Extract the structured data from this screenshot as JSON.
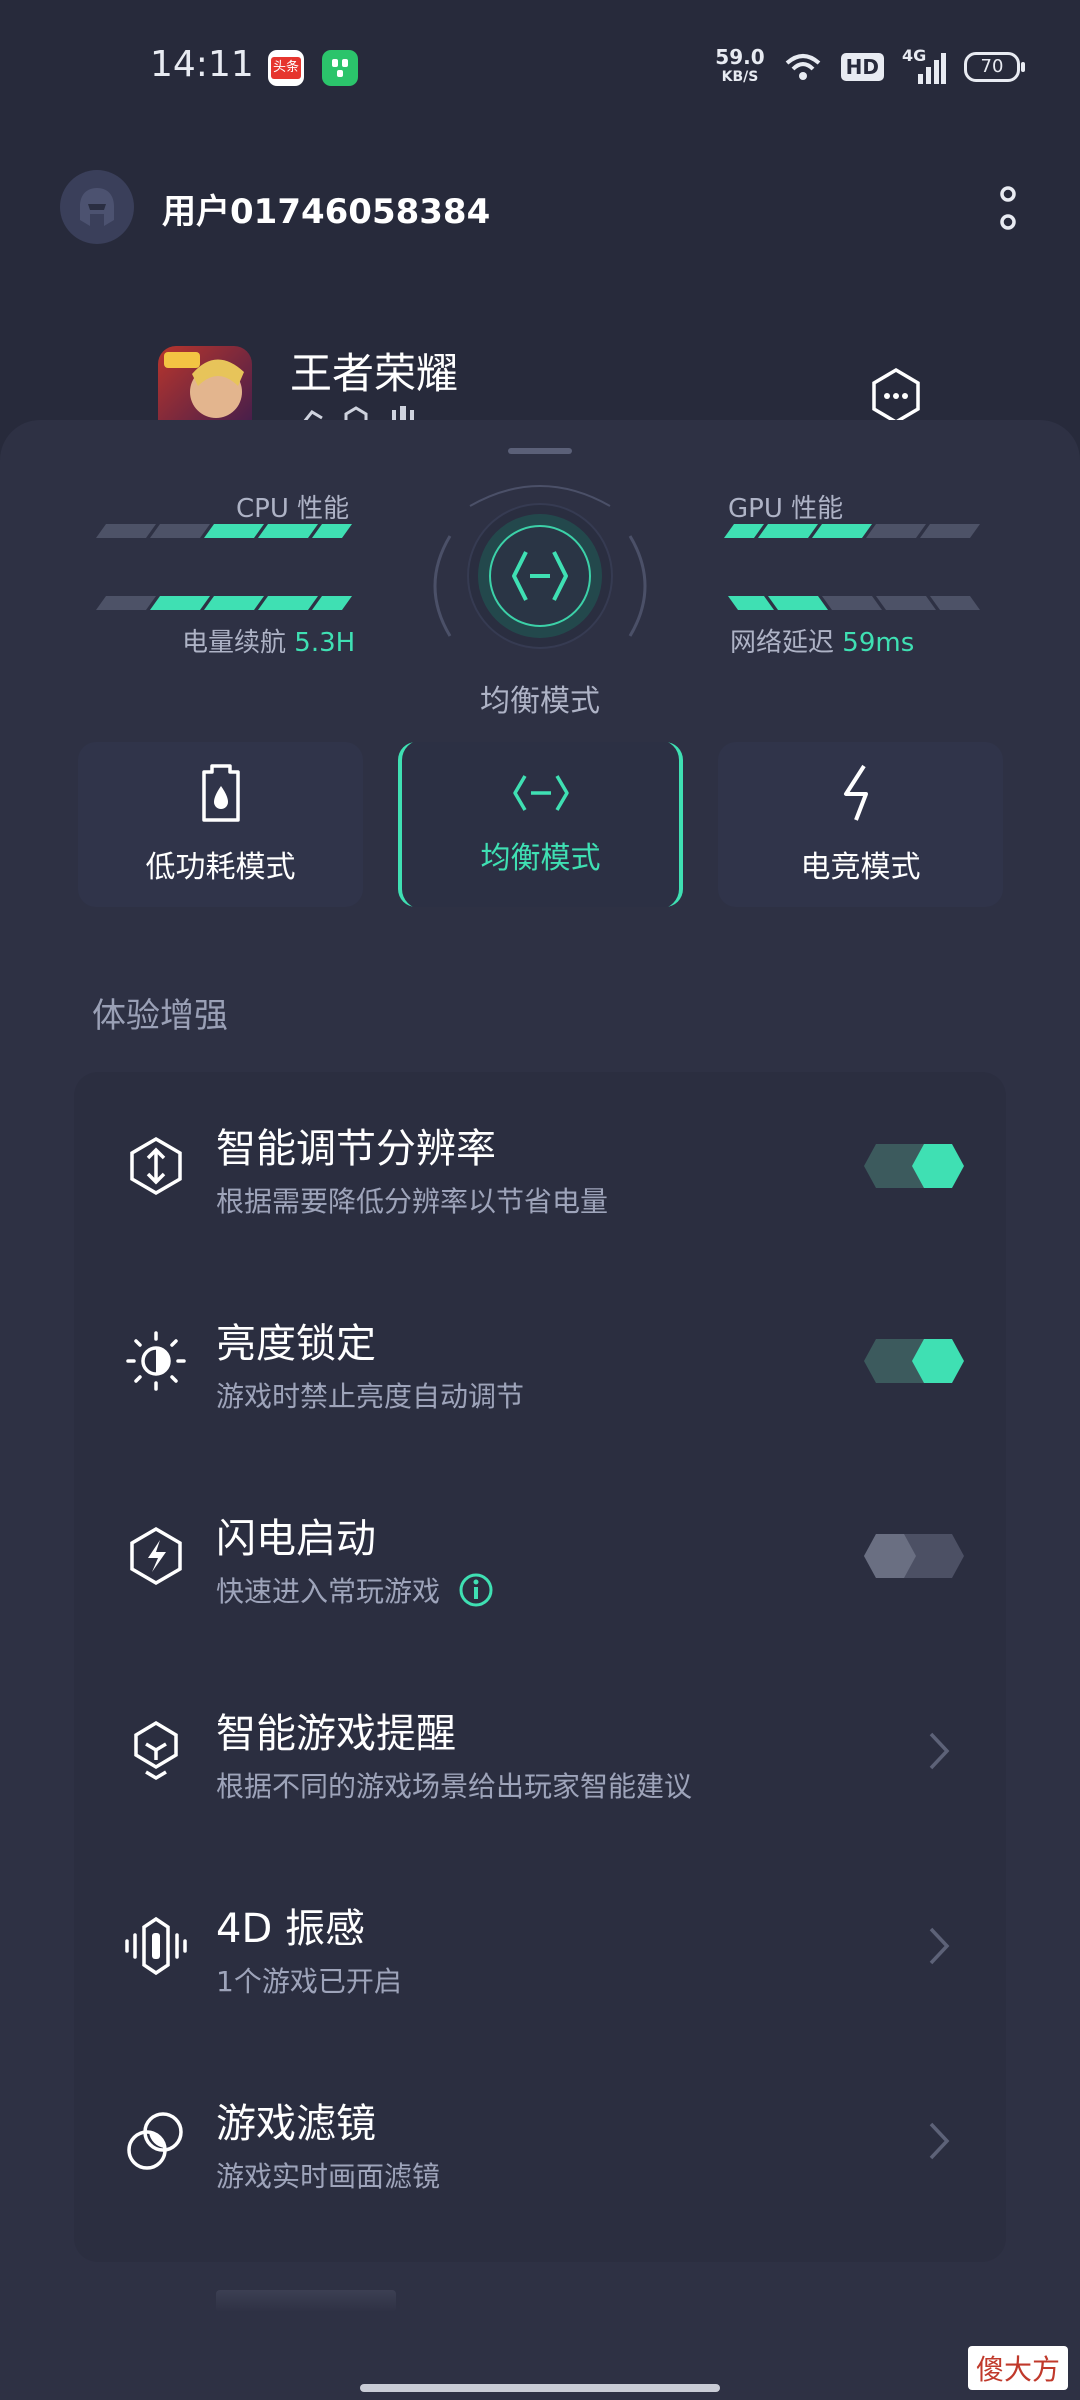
{
  "status_bar": {
    "time": "14:11",
    "speed_value": "59.0",
    "speed_unit": "KB/S",
    "hd": "HD",
    "network": "4G",
    "battery": "70",
    "app1_label": "头条"
  },
  "header": {
    "username": "用户01746058384"
  },
  "game": {
    "name": "王者荣耀"
  },
  "performance": {
    "cpu_label": "CPU 性能",
    "gpu_label": "GPU 性能",
    "battery_label": "电量续航",
    "battery_value": "5.3H",
    "latency_label": "网络延迟",
    "latency_value": "59ms",
    "current_mode": "均衡模式"
  },
  "modes": [
    {
      "label": "低功耗模式",
      "active": false
    },
    {
      "label": "均衡模式",
      "active": true
    },
    {
      "label": "电竞模式",
      "active": false
    }
  ],
  "section_title": "体验增强",
  "settings": [
    {
      "title": "智能调节分辨率",
      "subtitle": "根据需要降低分辨率以节省电量",
      "control": "toggle",
      "on": true,
      "icon": "resolution-icon"
    },
    {
      "title": "亮度锁定",
      "subtitle": "游戏时禁止亮度自动调节",
      "control": "toggle",
      "on": true,
      "icon": "brightness-icon"
    },
    {
      "title": "闪电启动",
      "subtitle": "快速进入常玩游戏",
      "control": "toggle",
      "on": false,
      "icon": "lightning-icon"
    },
    {
      "title": "智能游戏提醒",
      "subtitle": "根据不同的游戏场景给出玩家智能建议",
      "control": "chevron",
      "icon": "game-tip-icon"
    },
    {
      "title": "4D 振感",
      "subtitle": "1个游戏已开启",
      "control": "chevron",
      "icon": "vibration-icon"
    },
    {
      "title": "游戏滤镜",
      "subtitle": "游戏实时画面滤镜",
      "control": "chevron",
      "icon": "filter-icon"
    }
  ],
  "watermark": "傻大方",
  "colors": {
    "accent": "#3fe0b3",
    "background": "#272a3b",
    "panel": "#2b2e40"
  }
}
